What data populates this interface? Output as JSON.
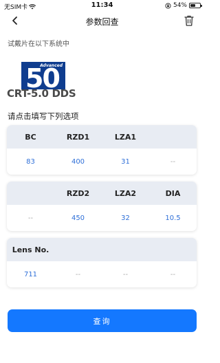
{
  "status_bar": {
    "carrier": "无SIM卡",
    "time": "11:34",
    "battery_text": "54%",
    "battery_level": 0.54
  },
  "nav": {
    "title": "参数回查"
  },
  "subtitle": "试戴片在以下系统中",
  "logo": {
    "top_text": "Advanced",
    "number": "50"
  },
  "product_name": "CRT-5.0 DDS",
  "section_label": "请点击填写下列选项",
  "card1": {
    "headers": [
      "BC",
      "RZD1",
      "LZA1",
      ""
    ],
    "values": [
      "83",
      "400",
      "31",
      "--"
    ]
  },
  "card2": {
    "headers": [
      "",
      "RZD2",
      "LZA2",
      "DIA"
    ],
    "values": [
      "--",
      "450",
      "32",
      "10.5"
    ]
  },
  "card3": {
    "headers": [
      "Lens No.",
      "",
      "",
      ""
    ],
    "values": [
      "711",
      "--",
      "--",
      "--"
    ]
  },
  "query_button": "查询",
  "colors": {
    "accent": "#1478ff",
    "value_text": "#2e6fd8",
    "header_bg": "#e8ecf3",
    "logo_bg": "#0f3d8f"
  }
}
